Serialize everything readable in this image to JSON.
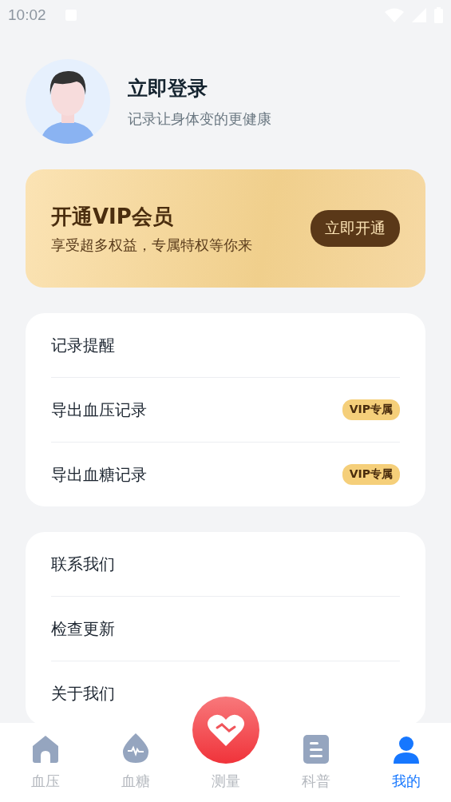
{
  "status_bar": {
    "time": "10:02"
  },
  "profile": {
    "title": "立即登录",
    "subtitle": "记录让身体变的更健康"
  },
  "vip_banner": {
    "title": "开通VIP会员",
    "subtitle": "享受超多权益，专属特权等你来",
    "button": "立即开通"
  },
  "menu_groups": [
    {
      "items": [
        {
          "label": "记录提醒"
        },
        {
          "label": "导出血压记录",
          "badge": "VIP专属"
        },
        {
          "label": "导出血糖记录",
          "badge": "VIP专属"
        }
      ]
    },
    {
      "items": [
        {
          "label": "联系我们"
        },
        {
          "label": "检查更新"
        },
        {
          "label": "关于我们"
        }
      ]
    }
  ],
  "tab_bar": [
    {
      "label": "血压",
      "kind": "home",
      "selected": false
    },
    {
      "label": "血糖",
      "kind": "drop",
      "selected": false
    },
    {
      "label": "测量",
      "kind": "measure",
      "selected": false
    },
    {
      "label": "科普",
      "kind": "doc",
      "selected": false
    },
    {
      "label": "我的",
      "kind": "person",
      "selected": true
    }
  ]
}
